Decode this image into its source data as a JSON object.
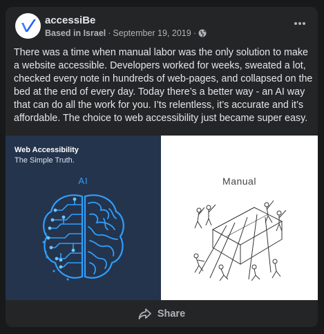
{
  "post": {
    "author": "accessiBe",
    "location": "Based in Israel",
    "separator": "·",
    "date": "September 19, 2019",
    "separator2": "·",
    "privacy_icon": "globe-icon",
    "more_icon": "more-options-icon",
    "text": "There was a time when manual labor was the only solution to make a website accessible. Developers worked for weeks, sweated a lot, checked every note in hundreds of web-pages, and collapsed on the bed at the end of every day. Today there’s a better way - an AI way that can do all  the work for you. I’ts relentless, it’s accurate and it’s affordable. The choice to web accessibility  just became super easy."
  },
  "image": {
    "left_title": "Web Accessibility",
    "left_subtitle": "The Simple Truth.",
    "left_label": "AI",
    "right_label": "Manual"
  },
  "actions": {
    "share_label": "Share",
    "share_icon": "share-arrow-icon"
  },
  "colors": {
    "background": "#18191a",
    "card": "#242526",
    "brand_blue": "#1f6bff",
    "ai_panel": "#24344d",
    "ai_glow": "#2ea0ff"
  }
}
